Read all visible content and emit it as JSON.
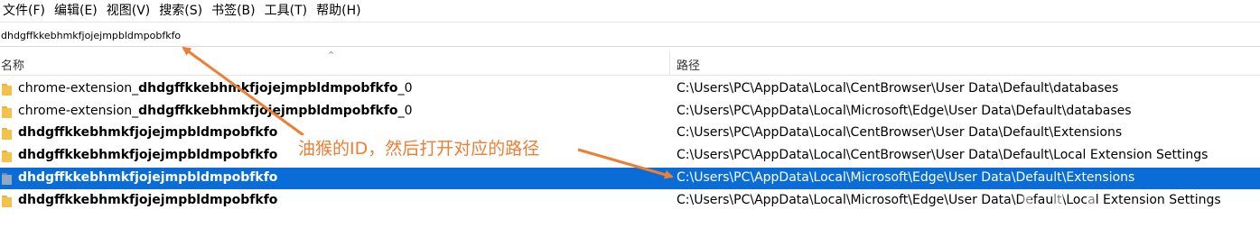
{
  "menu": [
    "文件(F)",
    "编辑(E)",
    "视图(V)",
    "搜索(S)",
    "书签(B)",
    "工具(T)",
    "帮助(H)"
  ],
  "search": {
    "value": "dhdgffkkebhmkfjojejmpbldmpobfkfo"
  },
  "columns": {
    "name": "名称",
    "path": "路径"
  },
  "rows": [
    {
      "prefix": "chrome-extension_",
      "bold": "dhdgffkkebhmkfjojejmpbldmpobfkfo",
      "suffix": "_0",
      "path": "C:\\Users\\PC\\AppData\\Local\\CentBrowser\\User Data\\Default\\databases"
    },
    {
      "prefix": "chrome-extension_",
      "bold": "dhdgffkkebhmkfjojejmpbldmpobfkfo",
      "suffix": "_0",
      "path": "C:\\Users\\PC\\AppData\\Local\\Microsoft\\Edge\\User Data\\Default\\databases"
    },
    {
      "prefix": "",
      "bold": "dhdgffkkebhmkfjojejmpbldmpobfkfo",
      "suffix": "",
      "path": "C:\\Users\\PC\\AppData\\Local\\CentBrowser\\User Data\\Default\\Extensions"
    },
    {
      "prefix": "",
      "bold": "dhdgffkkebhmkfjojejmpbldmpobfkfo",
      "suffix": "",
      "path": "C:\\Users\\PC\\AppData\\Local\\CentBrowser\\User Data\\Default\\Local Extension Settings"
    },
    {
      "prefix": "",
      "bold": "dhdgffkkebhmkfjojejmpbldmpobfkfo",
      "suffix": "",
      "path": "C:\\Users\\PC\\AppData\\Local\\Microsoft\\Edge\\User Data\\Default\\Extensions"
    },
    {
      "prefix": "",
      "bold": "dhdgffkkebhmkfjojejmpbldmpobfkfo",
      "suffix": "",
      "path": "C:\\Users\\PC\\AppData\\Local\\Microsoft\\Edge\\User Data\\Default\\Local Extension Settings"
    }
  ],
  "annotation": "油猴的ID，然后打开对应的路径",
  "colors": {
    "selection": "#0a6cd6",
    "annotation": "#ee7e33",
    "folder": "#f3c24a"
  }
}
